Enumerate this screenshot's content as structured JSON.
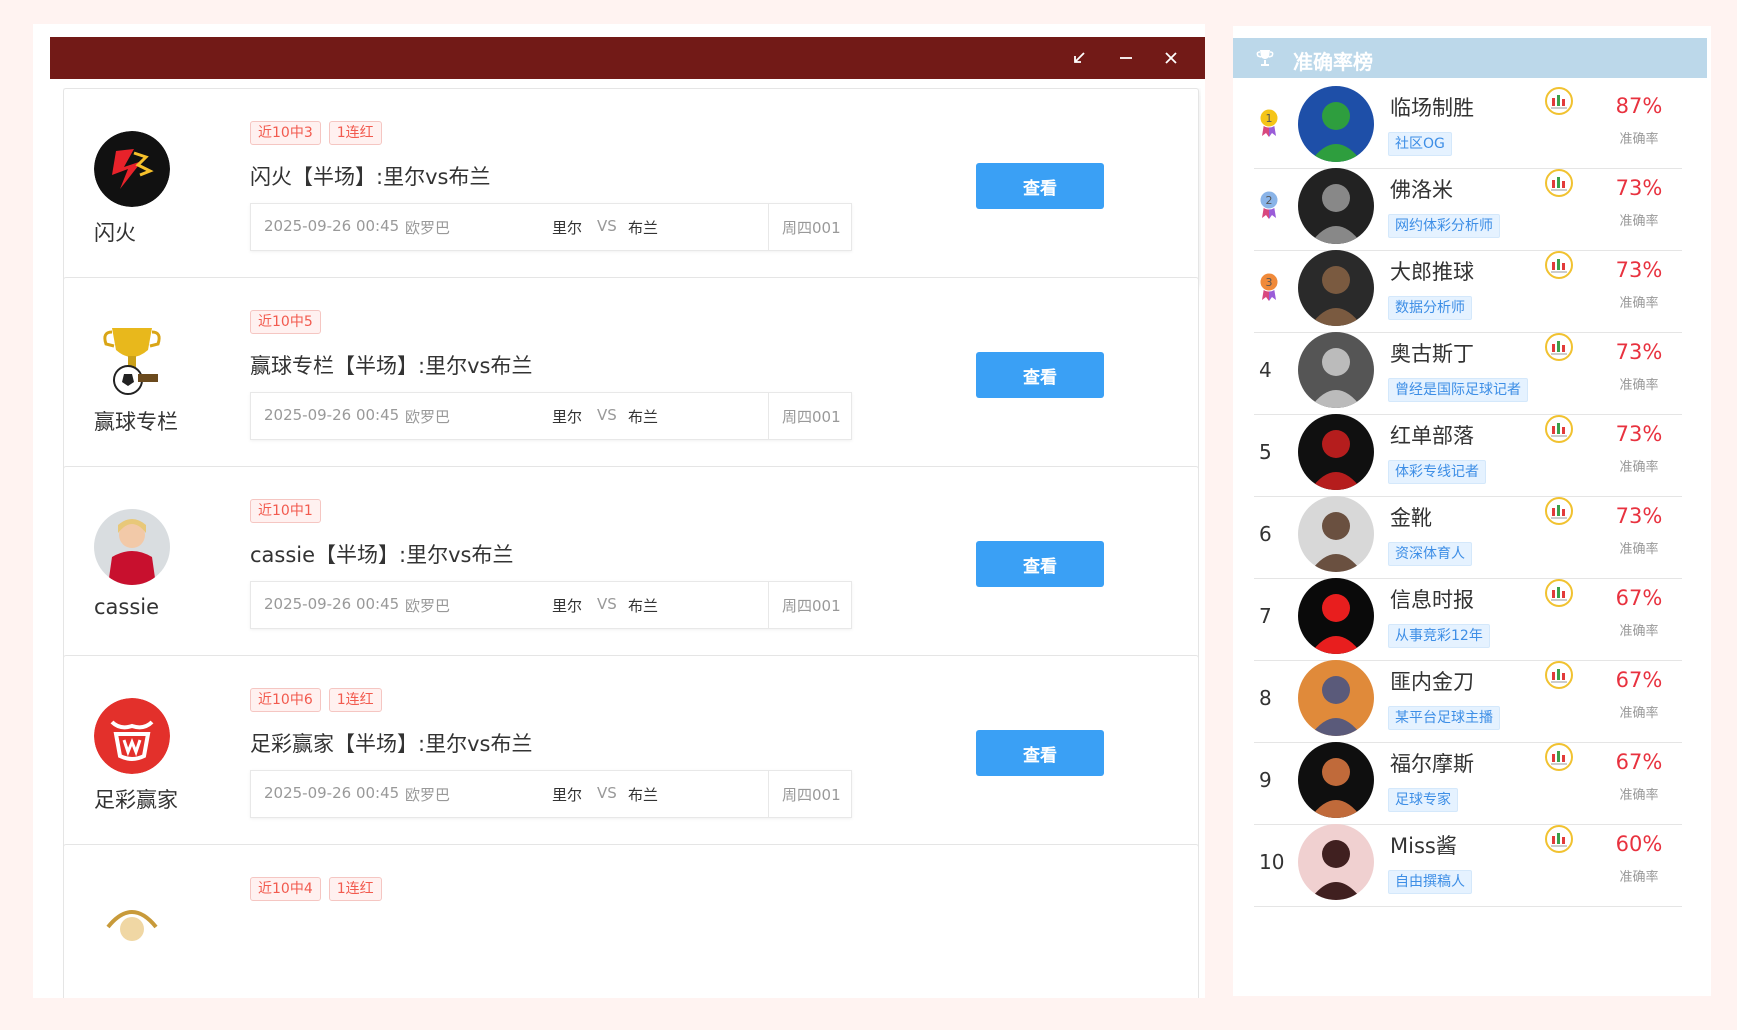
{
  "window": {
    "controls": [
      {
        "name": "restore-icon"
      },
      {
        "name": "minimize-icon"
      },
      {
        "name": "close-icon"
      }
    ]
  },
  "cards": [
    {
      "author": "闪火",
      "avatar": "flame-logo",
      "tags": [
        "近10中3",
        "1连红"
      ],
      "title": "闪火【半场】:里尔vs布兰",
      "datetime": "2025-09-26 00:45",
      "league": "欧罗巴",
      "home": "里尔",
      "vs": "VS",
      "away": "布兰",
      "code": "周四001",
      "button": "查看"
    },
    {
      "author": "赢球专栏",
      "avatar": "trophy-ball",
      "tags": [
        "近10中5"
      ],
      "title": "赢球专栏【半场】:里尔vs布兰",
      "datetime": "2025-09-26 00:45",
      "league": "欧罗巴",
      "home": "里尔",
      "vs": "VS",
      "away": "布兰",
      "code": "周四001",
      "button": "查看"
    },
    {
      "author": "cassie",
      "avatar": "player-photo",
      "tags": [
        "近10中1"
      ],
      "title": "cassie【半场】:里尔vs布兰",
      "datetime": "2025-09-26 00:45",
      "league": "欧罗巴",
      "home": "里尔",
      "vs": "VS",
      "away": "布兰",
      "code": "周四001",
      "button": "查看"
    },
    {
      "author": "足彩赢家",
      "avatar": "red-circle-logo",
      "tags": [
        "近10中6",
        "1连红"
      ],
      "title": "足彩赢家【半场】:里尔vs布兰",
      "datetime": "2025-09-26 00:45",
      "league": "欧罗巴",
      "home": "里尔",
      "vs": "VS",
      "away": "布兰",
      "code": "周四001",
      "button": "查看"
    },
    {
      "tags": [
        "近10中4",
        "1连红"
      ]
    }
  ],
  "ranking": {
    "title": "准确率榜",
    "rate_label": "准确率",
    "entries": [
      {
        "rank": "1",
        "name": "临场制胜",
        "tag": "社区OG",
        "pct": "87%"
      },
      {
        "rank": "2",
        "name": "佛洛米",
        "tag": "网约体彩分析师",
        "pct": "73%"
      },
      {
        "rank": "3",
        "name": "大郎推球",
        "tag": "数据分析师",
        "pct": "73%"
      },
      {
        "rank": "4",
        "name": "奥古斯丁",
        "tag": "曾经是国际足球记者",
        "pct": "73%"
      },
      {
        "rank": "5",
        "name": "红单部落",
        "tag": "体彩专线记者",
        "pct": "73%"
      },
      {
        "rank": "6",
        "name": "金靴",
        "tag": "资深体育人",
        "pct": "73%"
      },
      {
        "rank": "7",
        "name": "信息时报",
        "tag": "从事竞彩12年",
        "pct": "67%"
      },
      {
        "rank": "8",
        "name": "匪内金刀",
        "tag": "某平台足球主播",
        "pct": "67%"
      },
      {
        "rank": "9",
        "name": "福尔摩斯",
        "tag": "足球专家",
        "pct": "67%"
      },
      {
        "rank": "10",
        "name": "Miss酱",
        "tag": "自由撰稿人",
        "pct": "60%"
      }
    ]
  },
  "colors": {
    "titlebar": "#721a17",
    "button": "#3aa0f5",
    "tag_red": "#f25a4e",
    "pct_red": "#e8323f",
    "rank_header": "#bcd8ea"
  }
}
